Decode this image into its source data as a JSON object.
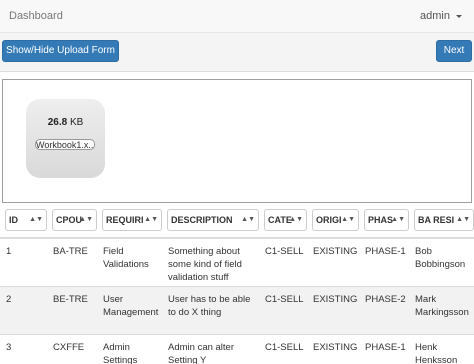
{
  "navbar": {
    "brand": "Dashboard",
    "user": "admin"
  },
  "toolbar": {
    "upload_label": "Show/Hide Upload Form",
    "next_label": "Next"
  },
  "dropzone": {
    "file": {
      "size_value": "26.8",
      "size_unit": "KB",
      "name": "Workbook1.x..."
    }
  },
  "table": {
    "columns": [
      "ID",
      "CPOU",
      "REQUIRI",
      "DESCRIPTION",
      "CATE",
      "ORIGI",
      "PHAS",
      "BA RESI"
    ],
    "rows": [
      [
        "1",
        "BA-TRE",
        "Field Validations",
        "Something about some kind of field validation stuff",
        "C1-SELL",
        "EXISTING",
        "PHASE-1",
        "Bob Bobbingson"
      ],
      [
        "2",
        "BE-TRE",
        "User Management",
        "User has to be able to do X thing",
        "C1-SELL",
        "EXISTING",
        "PHASE-2",
        "Mark Markingsson"
      ],
      [
        "3",
        "CXFFE",
        "Admin Settings",
        "Admin can alter Setting Y",
        "C1-SELL",
        "EXISTING",
        "PHASE-1",
        "Henk Henksson"
      ]
    ]
  }
}
